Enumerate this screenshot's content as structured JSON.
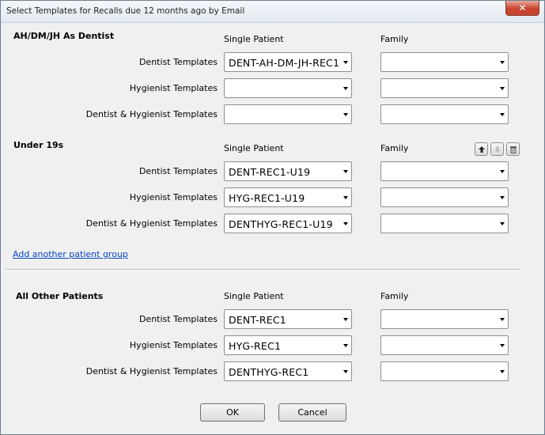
{
  "window": {
    "title": "Select Templates for Recalls due 12 months ago by Email",
    "close_glyph": "✕"
  },
  "column_headers": {
    "single": "Single Patient",
    "family": "Family"
  },
  "row_labels": {
    "dentist": "Dentist Templates",
    "hygienist": "Hygienist Templates",
    "both": "Dentist & Hygienist Templates"
  },
  "groups": [
    {
      "title": "AH/DM/JH As Dentist",
      "dentist_single": "DENT-AH-DM-JH-REC1",
      "dentist_family": "",
      "hygienist_single": "",
      "hygienist_family": "",
      "both_single": "",
      "both_family": ""
    },
    {
      "title": "Under 19s",
      "dentist_single": "DENT-REC1-U19",
      "dentist_family": "",
      "hygienist_single": "HYG-REC1-U19",
      "hygienist_family": "",
      "both_single": "DENTHYG-REC1-U19",
      "both_family": ""
    }
  ],
  "group_actions": {
    "move_up_icon": "arrow-up-icon",
    "move_down_icon": "arrow-down-icon",
    "delete_icon": "trash-icon"
  },
  "add_group_link": "Add another patient group",
  "other": {
    "title": "All Other Patients",
    "dentist_single": "DENT-REC1",
    "dentist_family": "",
    "hygienist_single": "HYG-REC1",
    "hygienist_family": "",
    "both_single": "DENTHYG-REC1",
    "both_family": ""
  },
  "buttons": {
    "ok": "OK",
    "cancel": "Cancel"
  }
}
